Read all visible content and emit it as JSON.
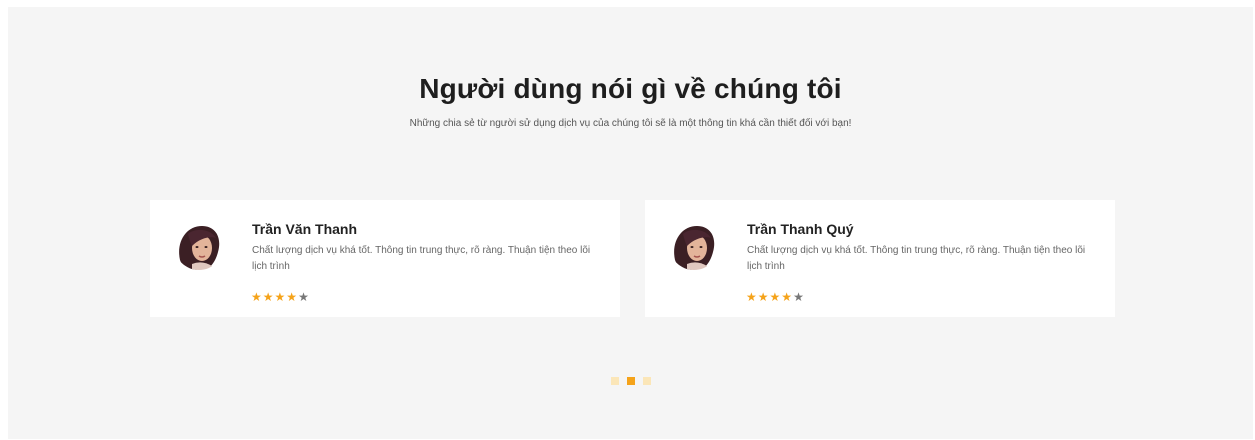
{
  "header": {
    "title": "Người dùng nói gì về chúng tôi",
    "subtitle": "Những chia sẻ từ người sử dụng dịch vụ của chúng tôi sẽ là một thông tin khá cần thiết đối với bạn!"
  },
  "testimonials": [
    {
      "name": "Trần Văn Thanh",
      "text": "Chất lượng dịch vụ khá tốt. Thông tin trung thực, rõ ràng. Thuận tiện theo lõi lịch trình",
      "rating": 4,
      "max_rating": 5
    },
    {
      "name": "Trần Thanh Quý",
      "text": "Chất lượng dịch vụ khá tốt. Thông tin trung thực, rõ ràng. Thuận tiện theo lõi lịch trình",
      "rating": 4,
      "max_rating": 5
    }
  ],
  "carousel": {
    "pages": 3,
    "active_index": 1
  },
  "colors": {
    "accent": "#f5a31a",
    "dot_inactive": "#fbe6b8",
    "section_bg": "#f5f5f5"
  }
}
